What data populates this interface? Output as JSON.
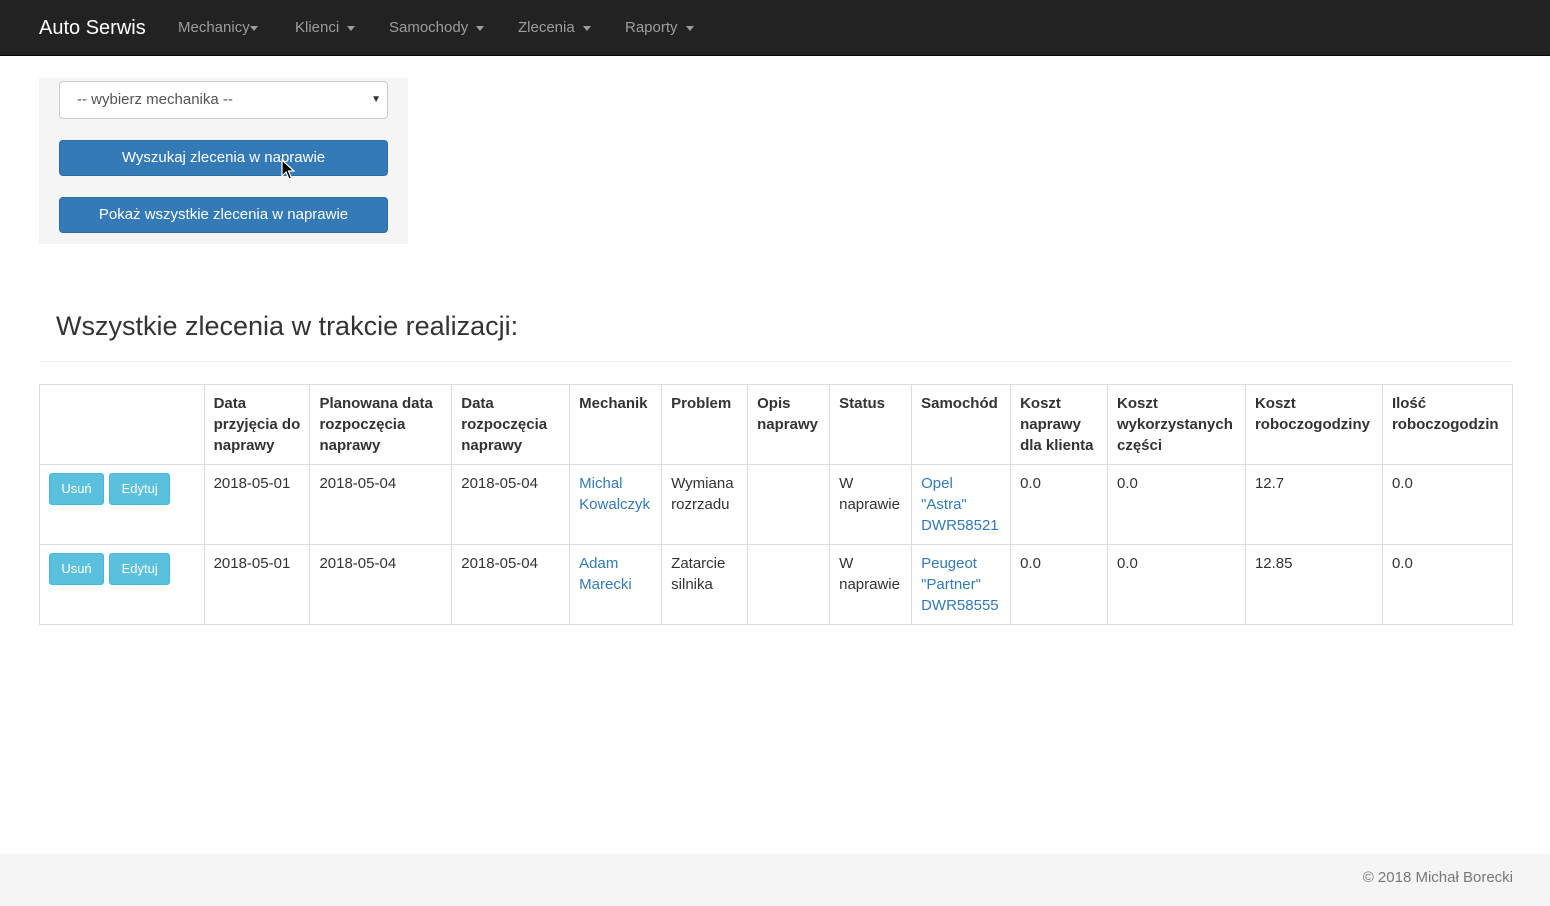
{
  "navbar": {
    "brand": "Auto Serwis",
    "items": [
      {
        "label": "Mechanicy"
      },
      {
        "label": "Klienci"
      },
      {
        "label": "Samochody"
      },
      {
        "label": "Zlecenia"
      },
      {
        "label": "Raporty"
      }
    ]
  },
  "search": {
    "mechanic_select_value": "-- wybierz mechanika --",
    "search_button": "Wyszukaj zlecenia w naprawie",
    "show_all_button": "Pokaż wszystkie zlecenia w naprawie"
  },
  "main": {
    "title": "Wszystkie zlecenia w trakcie realizacji:"
  },
  "table": {
    "headers": [
      "",
      "Data przyjęcia do naprawy",
      "Planowana data rozpoczęcia naprawy",
      "Data rozpoczęcia naprawy",
      "Mechanik",
      "Problem",
      "Opis naprawy",
      "Status",
      "Samochód",
      "Koszt naprawy dla klienta",
      "Koszt wykorzystanych części",
      "Koszt roboczogodziny",
      "Ilość roboczogodzin"
    ],
    "delete_label": "Usuń",
    "edit_label": "Edytuj",
    "rows": [
      {
        "received": "2018-05-01",
        "planned_start": "2018-05-04",
        "start": "2018-05-04",
        "mechanic": "Michal Kowalczyk",
        "problem": "Wymiana rozrzadu",
        "description": "",
        "status": "W naprawie",
        "car": "Opel \"Astra\" DWR58521",
        "client_cost": "0.0",
        "parts_cost": "0.0",
        "hour_cost": "12.7",
        "hours": "0.0"
      },
      {
        "received": "2018-05-01",
        "planned_start": "2018-05-04",
        "start": "2018-05-04",
        "mechanic": "Adam Marecki",
        "problem": "Zatarcie silnika",
        "description": "",
        "status": "W naprawie",
        "car": "Peugeot \"Partner\" DWR58555",
        "client_cost": "0.0",
        "parts_cost": "0.0",
        "hour_cost": "12.85",
        "hours": "0.0"
      }
    ]
  },
  "footer": {
    "text": "© 2018 Michał Borecki"
  }
}
